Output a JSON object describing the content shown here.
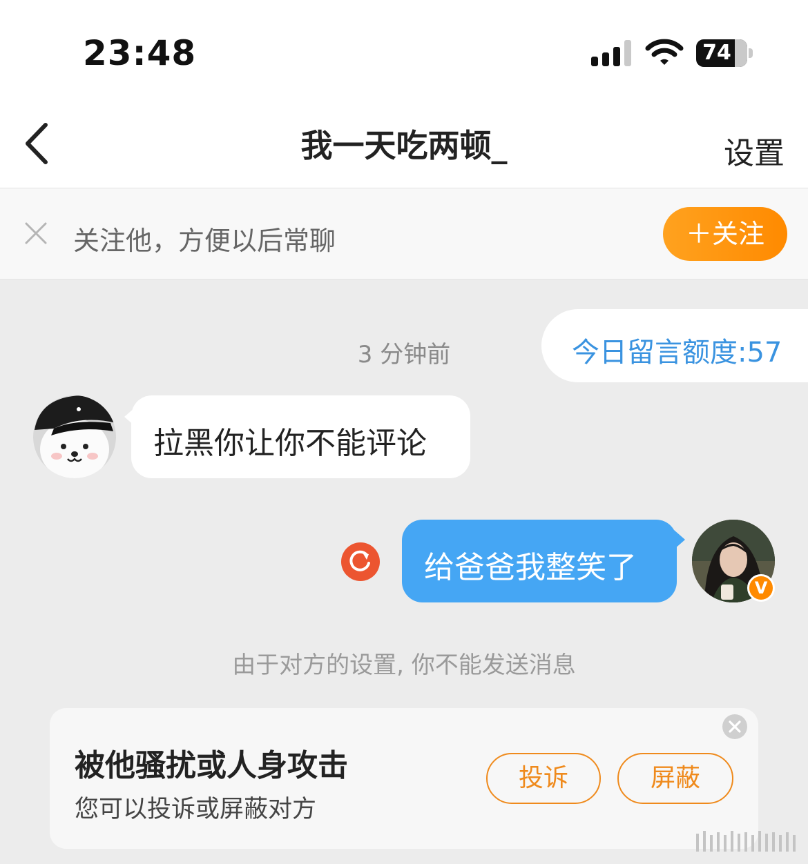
{
  "status_bar": {
    "time": "23:48",
    "battery": "74"
  },
  "header": {
    "title": "我一天吃两顿_",
    "settings_label": "设置"
  },
  "follow_banner": {
    "text": "关注他，方便以后常聊",
    "follow_button": "＋关注"
  },
  "chat": {
    "quota": "今日留言额度:57",
    "timestamp": "3 分钟前",
    "messages": [
      {
        "direction": "incoming",
        "text": "拉黑你让你不能评论"
      },
      {
        "direction": "outgoing",
        "text": "给爸爸我整笑了",
        "status": "failed"
      }
    ],
    "notice": "由于对方的设置, 你不能发送消息"
  },
  "harassment_card": {
    "title": "被他骚扰或人身攻击",
    "subtitle": "您可以投诉或屏蔽对方",
    "report_button": "投诉",
    "block_button": "屏蔽"
  },
  "badges": {
    "verified": "V"
  },
  "colors": {
    "accent_orange": "#ff8a00",
    "bubble_blue": "#45a6f4",
    "link_blue": "#3a93e0",
    "retry_red": "#ec5530"
  }
}
